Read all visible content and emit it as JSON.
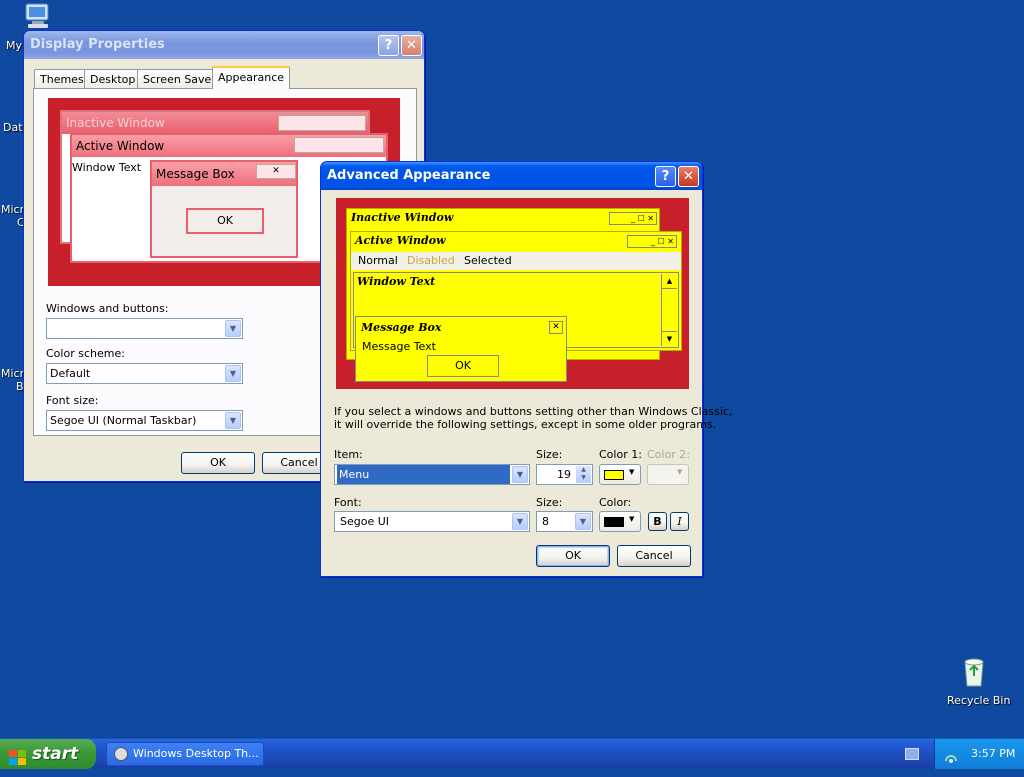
{
  "desktop": {
    "my_computer_label": "My",
    "dat_label": "Dat",
    "micro1_label": "Micro",
    "micro1_label2": "C",
    "micro2_label": "Micro",
    "micro2_label2": "B",
    "recycle_bin_label": "Recycle Bin"
  },
  "display_properties": {
    "title": "Display Properties",
    "help_label": "?",
    "close_label": "✕",
    "tabs": [
      "Themes",
      "Desktop",
      "Screen Saver",
      "Appearance"
    ],
    "preview": {
      "inactive_title": "Inactive Window",
      "active_title": "Active Window",
      "window_text": "Window Text",
      "message_box_title": "Message Box",
      "ok_label": "OK"
    },
    "windows_buttons_label": "Windows and buttons:",
    "windows_buttons_value": "",
    "color_scheme_label": "Color scheme:",
    "color_scheme_value": "Default",
    "font_size_label": "Font size:",
    "font_size_value": "Segoe UI (Normal Taskbar)",
    "ok_label": "OK",
    "cancel_label": "Cancel"
  },
  "advanced": {
    "title": "Advanced Appearance",
    "help_label": "?",
    "close_label": "✕",
    "preview": {
      "inactive_title": "Inactive Window",
      "active_title": "Active Window",
      "menu_normal": "Normal",
      "menu_disabled": "Disabled",
      "menu_selected": "Selected",
      "window_text": "Window Text",
      "message_box_title": "Message Box",
      "message_text": "Message Text",
      "ok_label": "OK"
    },
    "info_text_line1": "If you select a windows and buttons setting other than Windows Classic,",
    "info_text_line2": "it will override the following settings, except in some older programs.",
    "item_label": "Item:",
    "item_value": "Menu",
    "item_size_label": "Size:",
    "item_size_value": "19",
    "color1_label": "Color 1:",
    "color1_value": "#ffff00",
    "color2_label": "Color 2:",
    "font_label": "Font:",
    "font_value": "Segoe UI",
    "font_size_label": "Size:",
    "font_size_value": "8",
    "font_color_label": "Color:",
    "font_color_value": "#000000",
    "bold_label": "B",
    "italic_label": "I",
    "ok_label": "OK",
    "cancel_label": "Cancel"
  },
  "taskbar": {
    "start_label": "start",
    "task_label": "Windows Desktop Th...",
    "clock": "3:57 PM"
  },
  "colors": {
    "desktop": "#0f4aa0",
    "preview_red": "#c8202a",
    "scheme_yellow": "#ffff00"
  }
}
